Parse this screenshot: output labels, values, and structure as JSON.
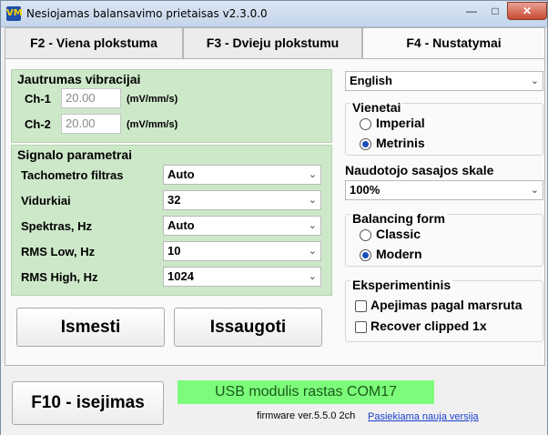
{
  "window": {
    "title": "Nesiojamas balansavimo prietaisas v2.3.0.0",
    "app_icon_text": "VM"
  },
  "tabs": [
    {
      "label": "F2 - Viena plokstuma",
      "active": false
    },
    {
      "label": "F3 - Dvieju plokstumu",
      "active": false
    },
    {
      "label": "F4 - Nustatymai",
      "active": true
    }
  ],
  "sensitivity": {
    "title": "Jautrumas vibracijai",
    "rows": [
      {
        "label": "Ch-1",
        "value": "20.00",
        "unit": "(mV/mm/s)"
      },
      {
        "label": "Ch-2",
        "value": "20.00",
        "unit": "(mV/mm/s)"
      }
    ]
  },
  "signal": {
    "title": "Signalo parametrai",
    "rows": [
      {
        "label": "Tachometro filtras",
        "value": "Auto"
      },
      {
        "label": "Vidurkiai",
        "value": "32"
      },
      {
        "label": "Spektras, Hz",
        "value": "Auto"
      },
      {
        "label": "RMS Low, Hz",
        "value": "10"
      },
      {
        "label": "RMS High, Hz",
        "value": "1024"
      }
    ]
  },
  "buttons": {
    "discard": "Ismesti",
    "save": "Issaugoti",
    "exit": "F10 - isejimas"
  },
  "language": {
    "value": "English"
  },
  "units": {
    "title": "Vienetai",
    "options": [
      {
        "label": "Imperial",
        "selected": false
      },
      {
        "label": "Metrinis",
        "selected": true
      }
    ]
  },
  "ui_scale": {
    "label": "Naudotojo sasajos skale",
    "value": "100%"
  },
  "balancing_form": {
    "title": "Balancing form",
    "options": [
      {
        "label": "Classic",
        "selected": false
      },
      {
        "label": "Modern",
        "selected": true
      }
    ]
  },
  "experimental": {
    "title": "Eksperimentinis",
    "options": [
      {
        "label": "Apejimas pagal marsruta",
        "checked": false
      },
      {
        "label": "Recover clipped 1x",
        "checked": false
      }
    ]
  },
  "footer": {
    "status": "USB modulis rastas COM17",
    "status_color": "#7cfc7a",
    "firmware": "firmware ver.5.5.0 2ch",
    "update_link": "Pasiekiama nauja versija"
  },
  "colors": {
    "panel_green": "#cde8c9",
    "link_blue": "#1a3fd0",
    "radio_blue": "#1a4fb7"
  }
}
